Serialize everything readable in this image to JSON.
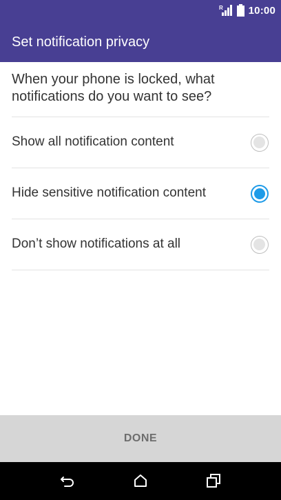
{
  "status_bar": {
    "time": "10:00",
    "icons": [
      "roaming-signal-icon",
      "battery-icon"
    ]
  },
  "app_bar": {
    "title": "Set notification privacy"
  },
  "prompt": "When your phone is locked, what notifications do you want to see?",
  "options": [
    {
      "label": "Show all notification content",
      "selected": false
    },
    {
      "label": "Hide sensitive notification content",
      "selected": true
    },
    {
      "label": "Don’t show notifications at all",
      "selected": false
    }
  ],
  "done_label": "DONE",
  "nav_bar": {
    "buttons": [
      "back-icon",
      "home-icon",
      "recents-icon"
    ]
  },
  "colors": {
    "primary": "#483f93",
    "accent": "#1e9be8",
    "done_bar": "#d6d6d6"
  }
}
